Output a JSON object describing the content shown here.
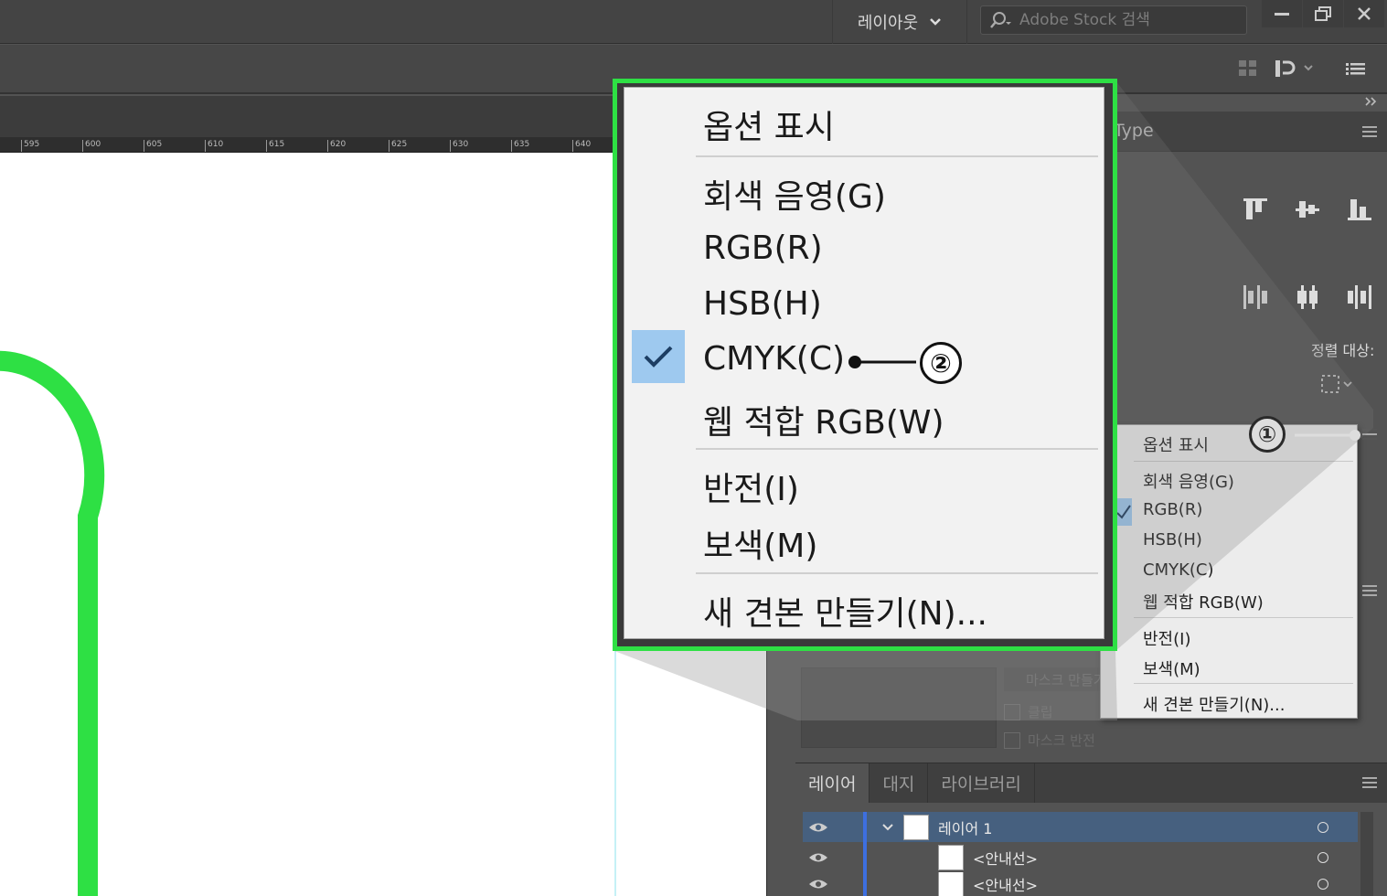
{
  "topbar": {
    "layout_label": "레이아웃",
    "search_placeholder": "Adobe Stock 검색"
  },
  "doc_panel_tab": "Type",
  "ruler_ticks": [
    "595",
    "600",
    "605",
    "610",
    "615",
    "620",
    "625",
    "630",
    "635",
    "640"
  ],
  "align": {
    "align_to_label": "정렬 대상:"
  },
  "color_menu_small": {
    "items": [
      "옵션 표시",
      "회색 음영(G)",
      "RGB(R)",
      "HSB(H)",
      "CMYK(C)",
      "웹 적합 RGB(W)",
      "반전(I)",
      "보색(M)",
      "새 견본 만들기(N)..."
    ],
    "checked": "RGB(R)"
  },
  "color_menu_zoom": {
    "items": [
      "옵션 표시",
      "회색 음영(G)",
      "RGB(R)",
      "HSB(H)",
      "CMYK(C)",
      "웹 적합 RGB(W)",
      "반전(I)",
      "보색(M)",
      "새 견본 만들기(N)..."
    ],
    "checked": "CMYK(C)"
  },
  "annotations": {
    "marker1": "①",
    "marker2": "②",
    "accent_color": "#2ee044"
  },
  "transparency": {
    "make_mask_label": "마스크 만들기",
    "clip_label": "클립",
    "invert_mask_label": "마스크 반전"
  },
  "layers": {
    "tabs": [
      "레이어",
      "대지",
      "라이브러리"
    ],
    "rows": [
      {
        "name": "레이어 1"
      },
      {
        "name": "<안내선>"
      },
      {
        "name": "<안내선>"
      }
    ]
  }
}
